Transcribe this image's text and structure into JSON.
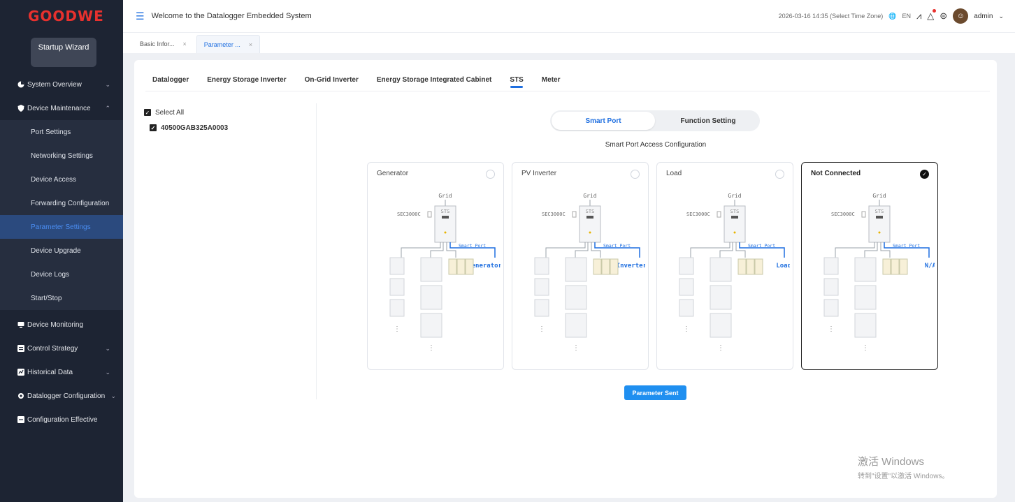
{
  "brand": {
    "logo_text": "GOODWE"
  },
  "sidebar": {
    "wizard_label": "Startup Wizard",
    "items": [
      {
        "label": "System Overview"
      },
      {
        "label": "Device Maintenance"
      },
      {
        "label": "Device Monitoring"
      },
      {
        "label": "Control Strategy"
      },
      {
        "label": "Historical Data"
      },
      {
        "label": "Datalogger Configuration"
      },
      {
        "label": "Configuration Effective"
      }
    ],
    "sub_items": [
      {
        "label": "Port Settings"
      },
      {
        "label": "Networking Settings"
      },
      {
        "label": "Device Access"
      },
      {
        "label": "Forwarding Configuration"
      },
      {
        "label": "Parameter Settings"
      },
      {
        "label": "Device Upgrade"
      },
      {
        "label": "Device Logs"
      },
      {
        "label": "Start/Stop"
      }
    ]
  },
  "header": {
    "welcome": "Welcome to the Datalogger Embedded System",
    "datetime": "2026-03-16 14:35 (Select Time Zone)",
    "language": "EN",
    "user": "admin"
  },
  "page_tabs": [
    {
      "label": "Basic Infor..."
    },
    {
      "label": "Parameter ..."
    }
  ],
  "device_tabs": [
    "Datalogger",
    "Energy Storage Inverter",
    "On-Grid Inverter",
    "Energy Storage Integrated Cabinet",
    "STS",
    "Meter"
  ],
  "tree": {
    "select_all": "Select All",
    "device_sn": "40500GAB325A0003"
  },
  "toggle": {
    "smart_port": "Smart Port",
    "function_setting": "Function Setting"
  },
  "section_title": "Smart Port Access Configuration",
  "options": [
    {
      "title": "Generator",
      "diagram_label": "Generator"
    },
    {
      "title": "PV Inverter",
      "diagram_label": "PV Inverter"
    },
    {
      "title": "Load",
      "diagram_label": "Load"
    },
    {
      "title": "Not Connected",
      "diagram_label": "N/A"
    }
  ],
  "diagram": {
    "grid": "Grid",
    "sts": "STS",
    "model": "SEC3000C",
    "smart_port": "Smart Port"
  },
  "send_button": "Parameter Sent",
  "windows_activate": {
    "line1": "激活 Windows",
    "line2": "转到\"设置\"以激活 Windows。"
  },
  "colors": {
    "accent": "#1f6fe0",
    "sidebar_bg": "#1d2433",
    "logo": "#e8312e"
  }
}
